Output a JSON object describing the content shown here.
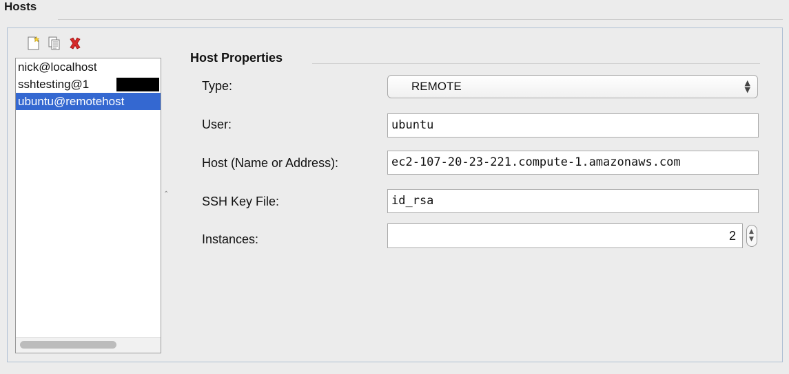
{
  "section": {
    "title": "Hosts"
  },
  "toolbar": {
    "buttons": [
      {
        "name": "new-host",
        "icon": "new-document-icon"
      },
      {
        "name": "copy-host",
        "icon": "copy-document-icon"
      },
      {
        "name": "delete-host",
        "icon": "delete-x-icon"
      }
    ]
  },
  "hosts": {
    "items": [
      {
        "label": "nick@localhost",
        "selected": false
      },
      {
        "label": "sshtesting@1",
        "selected": false,
        "redacted": true
      },
      {
        "label": "ubuntu@remotehost",
        "selected": true
      }
    ]
  },
  "properties": {
    "title": "Host Properties",
    "type": {
      "label": "Type:",
      "value": "REMOTE",
      "arrow": "⌃⌄"
    },
    "user": {
      "label": "User:",
      "value": "ubuntu"
    },
    "host": {
      "label": "Host (Name or Address):",
      "value": "ec2-107-20-23-221.compute-1.amazonaws.com"
    },
    "ssh_key": {
      "label": "SSH Key File:",
      "value": "id_rsa"
    },
    "instances": {
      "label": "Instances:",
      "value": "2"
    }
  },
  "colors": {
    "selection": "#3468d1",
    "delete_icon": "#d62b2b",
    "panel_border": "#aebfd3"
  }
}
